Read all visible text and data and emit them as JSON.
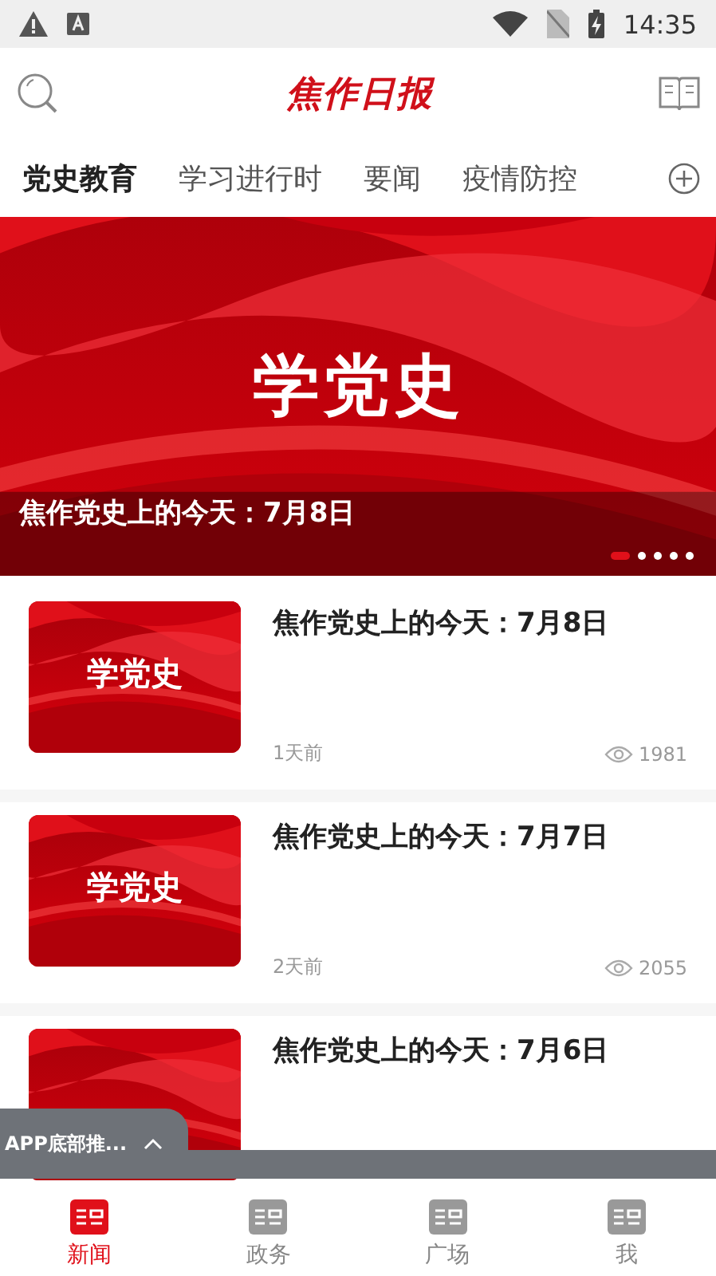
{
  "status_bar": {
    "time": "14:35"
  },
  "header": {
    "logo": "焦作日报"
  },
  "tabs": [
    {
      "label": "党史教育",
      "selected": true
    },
    {
      "label": "学习进行时",
      "selected": false
    },
    {
      "label": "要闻",
      "selected": false
    },
    {
      "label": "疫情防控",
      "selected": false
    }
  ],
  "banner": {
    "title": "焦作党史上的今天：7月8日",
    "thumb_text": "学党史",
    "dots": [
      {
        "selected": true
      },
      {
        "selected": false
      },
      {
        "selected": false
      },
      {
        "selected": false
      },
      {
        "selected": false
      }
    ]
  },
  "articles": [
    {
      "title": "焦作党史上的今天：7月8日",
      "thumb_text": "学党史",
      "time": "1天前",
      "views": "1981"
    },
    {
      "title": "焦作党史上的今天：7月7日",
      "thumb_text": "学党史",
      "time": "2天前",
      "views": "2055"
    },
    {
      "title": "焦作党史上的今天：7月6日"
    }
  ],
  "float_tab": {
    "label": "APP底部推..."
  },
  "bottom_nav": [
    {
      "label": "新闻",
      "selected": true
    },
    {
      "label": "政务",
      "selected": false
    },
    {
      "label": "广场",
      "selected": false
    },
    {
      "label": "我",
      "selected": false
    }
  ]
}
